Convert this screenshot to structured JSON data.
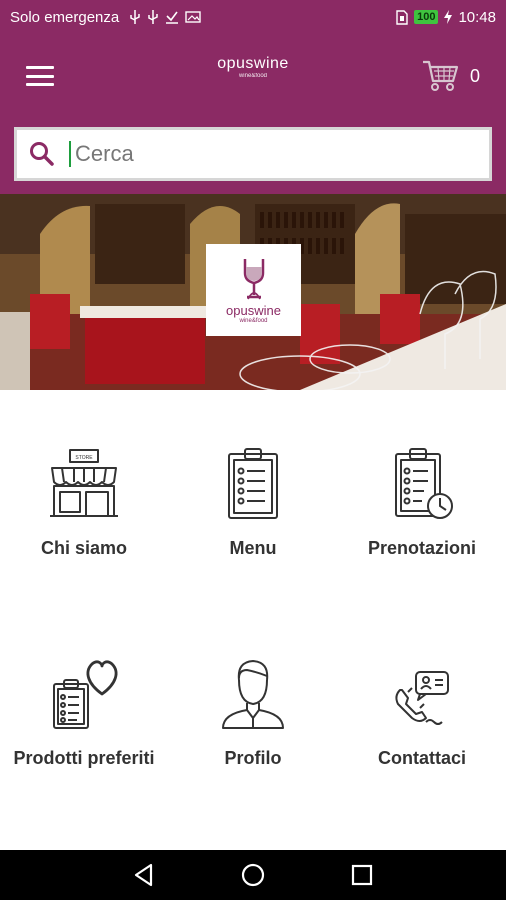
{
  "status_bar": {
    "carrier": "Solo emergenza",
    "battery": "100",
    "time": "10:48",
    "icons": [
      "usb-icon",
      "usb-icon",
      "download-done-icon",
      "image-icon",
      "sim-icon",
      "charging-icon"
    ]
  },
  "app_bar": {
    "logo_main": "opuswine",
    "logo_sub": "wine&food",
    "cart_count": "0"
  },
  "search": {
    "placeholder": "Cerca",
    "value": ""
  },
  "hero": {
    "logo_main": "opuswine",
    "logo_sub": "wine&food"
  },
  "menu_tiles": [
    {
      "label": "Chi siamo",
      "icon": "store-icon"
    },
    {
      "label": "Menu",
      "icon": "clipboard-list-icon"
    },
    {
      "label": "Prenotazioni",
      "icon": "clipboard-clock-icon"
    },
    {
      "label": "Prodotti preferiti",
      "icon": "clipboard-heart-icon"
    },
    {
      "label": "Profilo",
      "icon": "user-profile-icon"
    },
    {
      "label": "Contattaci",
      "icon": "phone-contact-icon"
    }
  ],
  "colors": {
    "brand": "#8b2a64",
    "nav_bar": "#000000",
    "battery": "#3fc43f"
  }
}
